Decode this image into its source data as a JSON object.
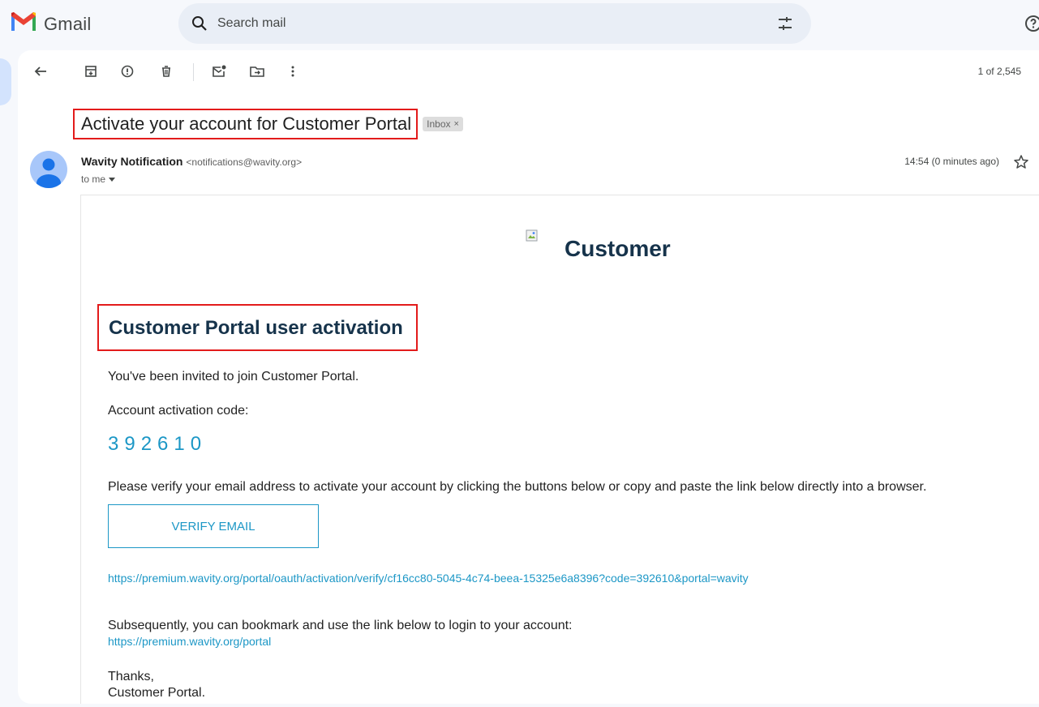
{
  "app": {
    "name": "Gmail"
  },
  "search": {
    "placeholder": "Search mail"
  },
  "toolbar": {
    "back_icon": "arrow-left-icon",
    "actions": [
      "archive-icon",
      "report-spam-icon",
      "delete-icon",
      "mark-unread-icon",
      "move-to-icon",
      "more-icon"
    ],
    "counter": "1 of 2,545"
  },
  "message": {
    "subject": "Activate your account for Customer Portal",
    "label": "Inbox",
    "label_remove": "×",
    "sender_name": "Wavity Notification",
    "sender_email": "<notifications@wavity.org>",
    "to": "to me",
    "time": "14:54 (0 minutes ago)"
  },
  "email": {
    "brand": "Customer",
    "heading": "Customer Portal user activation",
    "invite_text": "You've been invited to join Customer Portal.",
    "code_label": "Account activation code:",
    "code": "392610",
    "verify_text": "Please verify your email address to activate your account by clicking the buttons below or copy and paste the link below directly into a browser.",
    "verify_button": "VERIFY EMAIL",
    "verify_link": "https://premium.wavity.org/portal/oauth/activation/verify/cf16cc80-5045-4c74-beea-15325e6a8396?code=392610&portal=wavity",
    "bookmark_text": "Subsequently, you can bookmark and use the link below to login to your account:",
    "portal_link": "https://premium.wavity.org/portal",
    "thanks": "Thanks,",
    "signature": "Customer Portal."
  },
  "colors": {
    "accent_link": "#1c97c6",
    "heading": "#16334b",
    "highlight_box": "#e31b1b",
    "search_bg": "#e9eef6"
  }
}
